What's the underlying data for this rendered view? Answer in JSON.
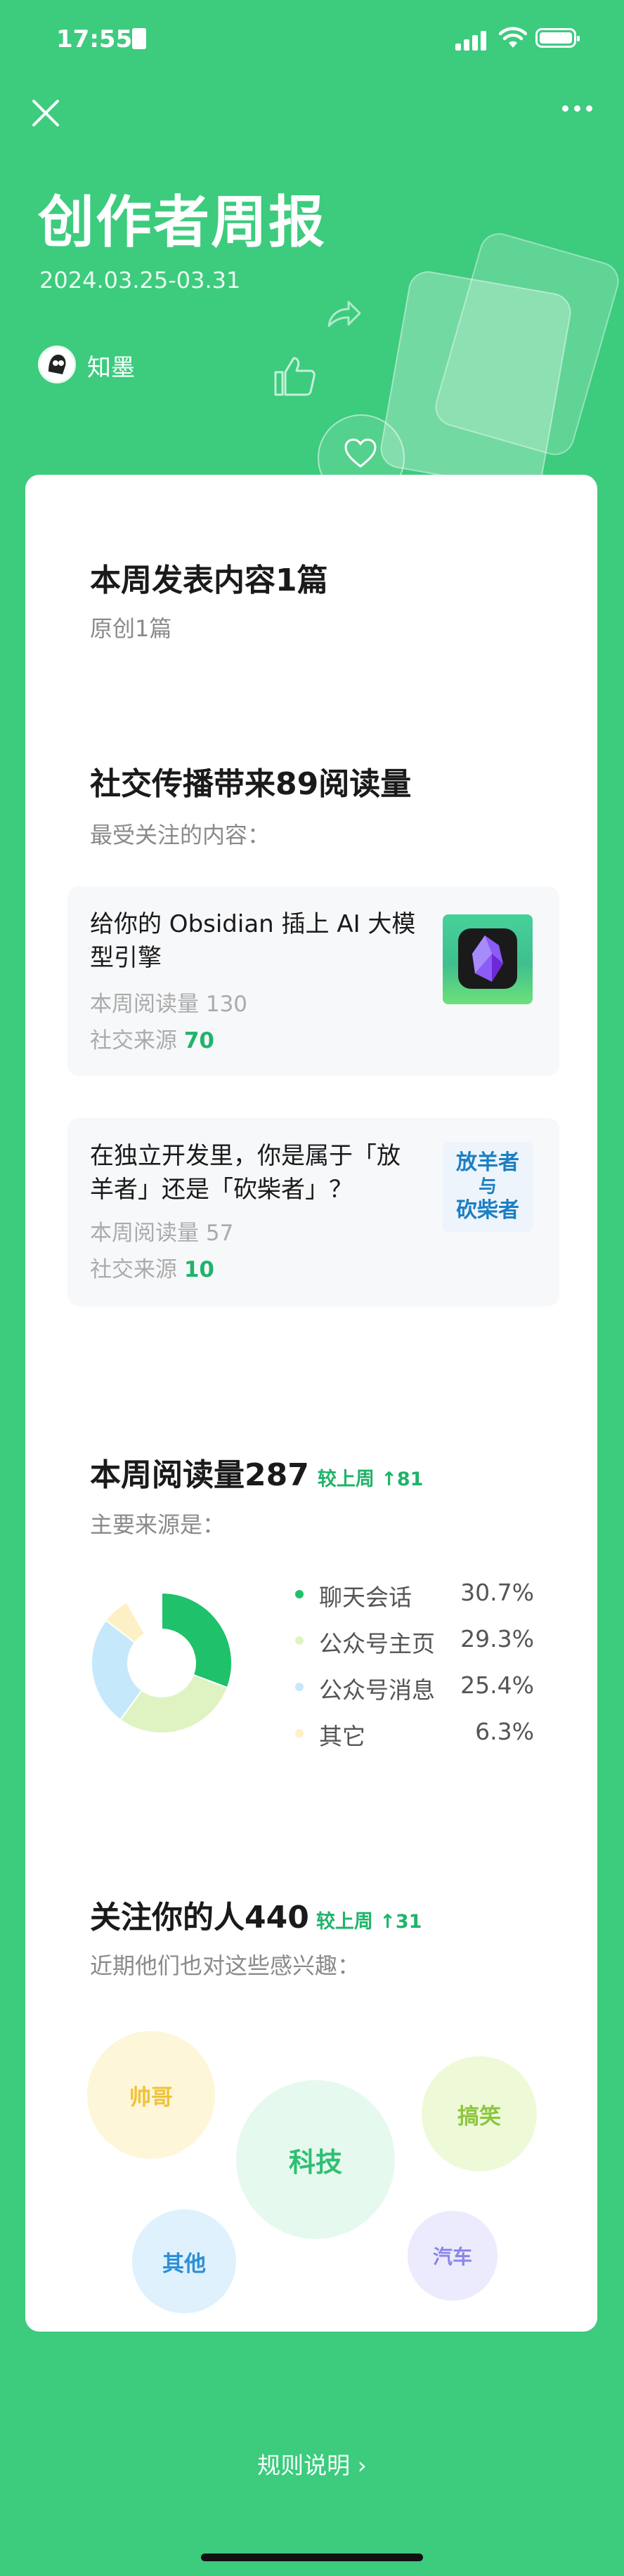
{
  "status": {
    "time": "17:55"
  },
  "header": {
    "title": "创作者周报",
    "date_range": "2024.03.25-03.31",
    "author": "知墨"
  },
  "publish": {
    "heading": "本周发表内容1篇",
    "sub": "原创1篇"
  },
  "social": {
    "heading": "社交传播带来89阅读量",
    "sub": "最受关注的内容：",
    "articles": [
      {
        "title": "给你的 Obsidian 插上 AI 大模型引擎",
        "reads_label": "本周阅读量",
        "reads": "130",
        "social_label": "社交来源",
        "social": "70"
      },
      {
        "title": "在独立开发里，你是属于「放羊者」还是「砍柴者」？",
        "reads_label": "本周阅读量",
        "reads": "57",
        "social_label": "社交来源",
        "social": "10",
        "thumb_text": [
          "放羊者",
          "与",
          "砍柴者"
        ]
      }
    ]
  },
  "reads": {
    "heading": "本周阅读量287",
    "delta": "较上周 ↑81",
    "sub": "主要来源是：",
    "sources": [
      {
        "label": "聊天会话",
        "pct": "30.7%",
        "color": "#1fc16b",
        "value": 30.7
      },
      {
        "label": "公众号主页",
        "pct": "29.3%",
        "color": "#dff3c2",
        "value": 29.3
      },
      {
        "label": "公众号消息",
        "pct": "25.4%",
        "color": "#c6e8fb",
        "value": 25.4
      },
      {
        "label": "其它",
        "pct": "6.3%",
        "color": "#fdf0c6",
        "value": 6.3
      }
    ]
  },
  "followers": {
    "heading": "关注你的人440",
    "delta": "较上周 ↑31",
    "sub": "近期他们也对这些感兴趣：",
    "interests": [
      "帅哥",
      "科技",
      "搞笑",
      "其他",
      "汽车"
    ]
  },
  "footer": {
    "rules": "规则说明"
  }
}
